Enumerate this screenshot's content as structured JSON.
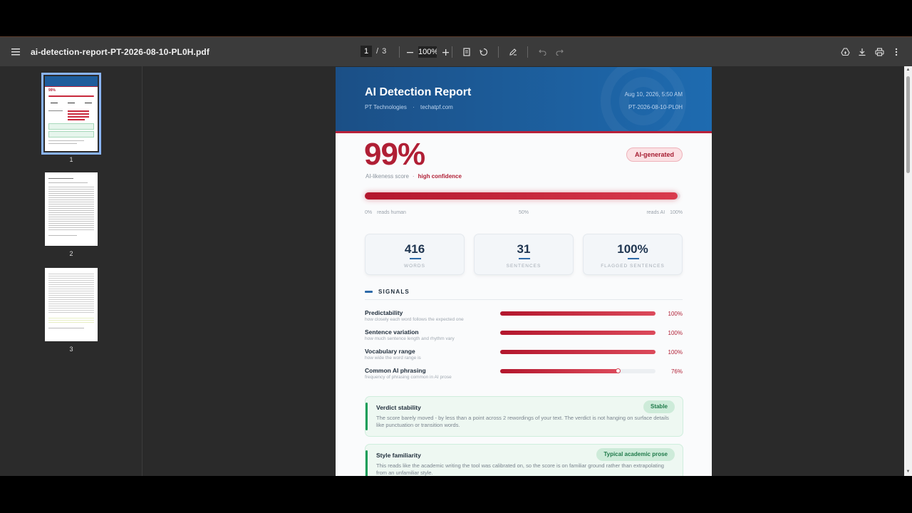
{
  "toolbar": {
    "file_name": "ai-detection-report-PT-2026-08-10-PL0H.pdf",
    "current_page": "1",
    "page_separator": "/",
    "total_pages": "3",
    "zoom": "100%"
  },
  "thumbnails": [
    {
      "label": "1",
      "selected": true
    },
    {
      "label": "2",
      "selected": false
    },
    {
      "label": "3",
      "selected": false
    }
  ],
  "report": {
    "title": "AI Detection Report",
    "org": "PT Technologies",
    "org_sep": "·",
    "site": "techatpf.com",
    "date": "Aug 10, 2026, 5:50 AM",
    "report_id": "PT-2026-08-10-PL0H",
    "score": "99%",
    "score_fraction": 0.99,
    "score_label": "AI-likeness score",
    "score_sep": "·",
    "confidence": "high confidence",
    "verdict_badge": "AI-generated",
    "scale": {
      "left_pct": "0%",
      "left_text": "reads human",
      "mid": "50%",
      "right_text": "reads AI",
      "right_pct": "100%"
    },
    "stats": [
      {
        "value": "416",
        "label": "WORDS"
      },
      {
        "value": "31",
        "label": "SENTENCES"
      },
      {
        "value": "100%",
        "label": "FLAGGED SENTENCES"
      }
    ],
    "signals_title": "SIGNALS",
    "signals": [
      {
        "name": "Predictability",
        "desc": "how closely each word follows the expected one",
        "pct": "100%",
        "level": 1.0
      },
      {
        "name": "Sentence variation",
        "desc": "how much sentence length and rhythm vary",
        "pct": "100%",
        "level": 1.0
      },
      {
        "name": "Vocabulary range",
        "desc": "how wide the word range is",
        "pct": "100%",
        "level": 1.0
      },
      {
        "name": "Common AI phrasing",
        "desc": "frequency of phrasing common in AI prose",
        "pct": "76%",
        "level": 0.76
      }
    ],
    "cards": [
      {
        "title": "Verdict stability",
        "tag": "Stable",
        "body": "The score barely moved - by less than a point across 2 rewordings of your text. The verdict is not hanging on surface details like punctuation or transition words."
      },
      {
        "title": "Style familiarity",
        "tag": "Typical academic prose",
        "body": "This reads like the academic writing the tool was calibrated on, so the score is on familiar ground rather than extrapolating from an unfamiliar style."
      }
    ]
  },
  "colors": {
    "accent_red": "#b01f35",
    "header_blue": "#1b4f86",
    "green": "#1f9d5a"
  },
  "icons": {
    "menu": "hamburger-icon",
    "zoom_out": "minus-icon",
    "zoom_in": "plus-icon",
    "fit": "fit-page-icon",
    "rotate": "rotate-icon",
    "annotate": "pen-icon",
    "undo": "undo-icon",
    "redo": "redo-icon",
    "drive": "drive-icon",
    "download": "download-icon",
    "print": "print-icon",
    "more": "more-vert-icon"
  }
}
